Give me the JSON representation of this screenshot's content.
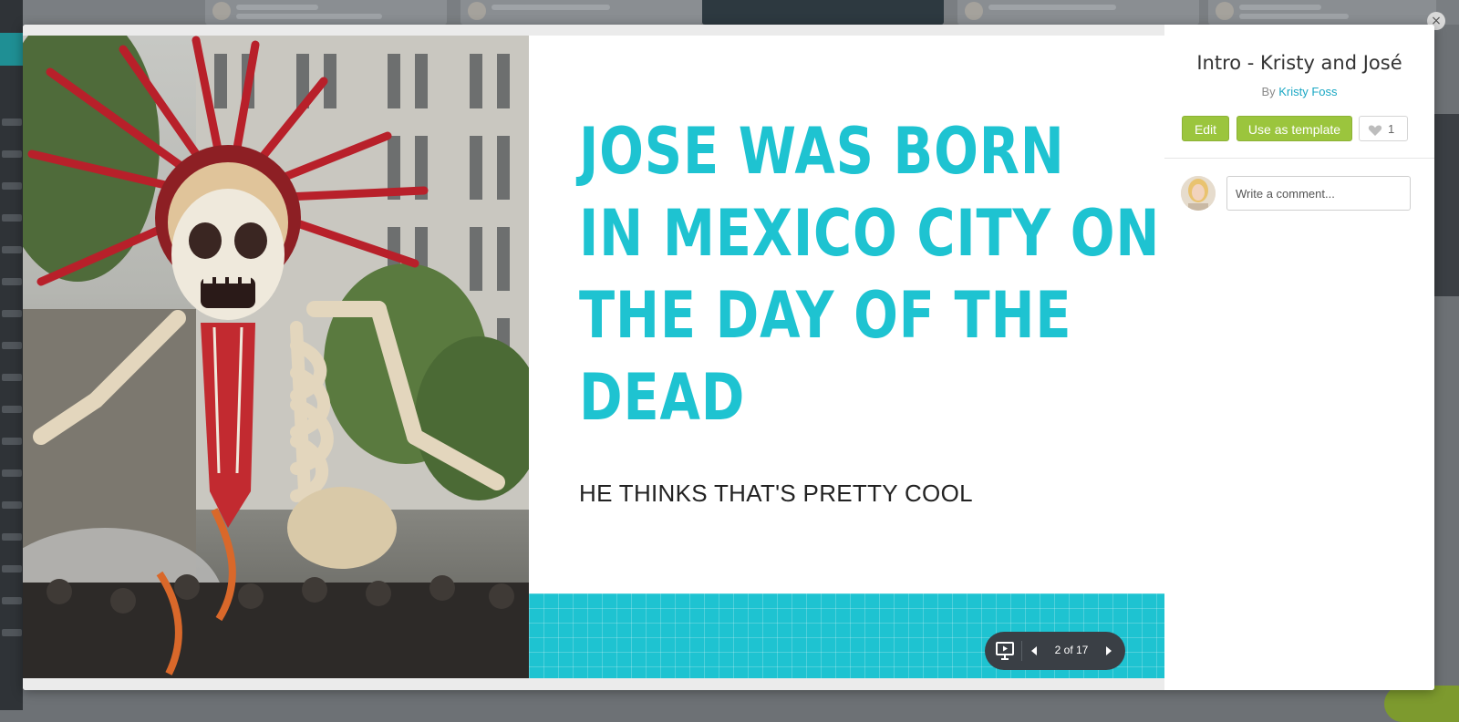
{
  "modal": {
    "close_icon": "close-icon",
    "close_symbol": "×"
  },
  "slide": {
    "headline_lines": [
      "JOSE WAS BORN",
      "IN MEXICO CITY ON",
      "THE DAY OF THE",
      "DEAD"
    ],
    "subtext": "HE THINKS THAT'S PRETTY COOL",
    "photo_icon": "day-of-the-dead-skeleton-parade-photo",
    "accent_color": "#1ec3d1"
  },
  "viewer": {
    "present_icon": "present-icon",
    "prev_icon": "chevron-left-icon",
    "next_icon": "chevron-right-icon",
    "page_indicator": "2 of 17"
  },
  "panel": {
    "title": "Intro - Kristy and José",
    "by_prefix": "By",
    "author": "Kristy Foss",
    "edit_label": "Edit",
    "template_label": "Use as template",
    "like_icon": "heart-icon",
    "like_count": "1",
    "comment_placeholder": "Write a comment...",
    "brand_green": "#9bc53d",
    "link_color": "#1ba8c4"
  }
}
